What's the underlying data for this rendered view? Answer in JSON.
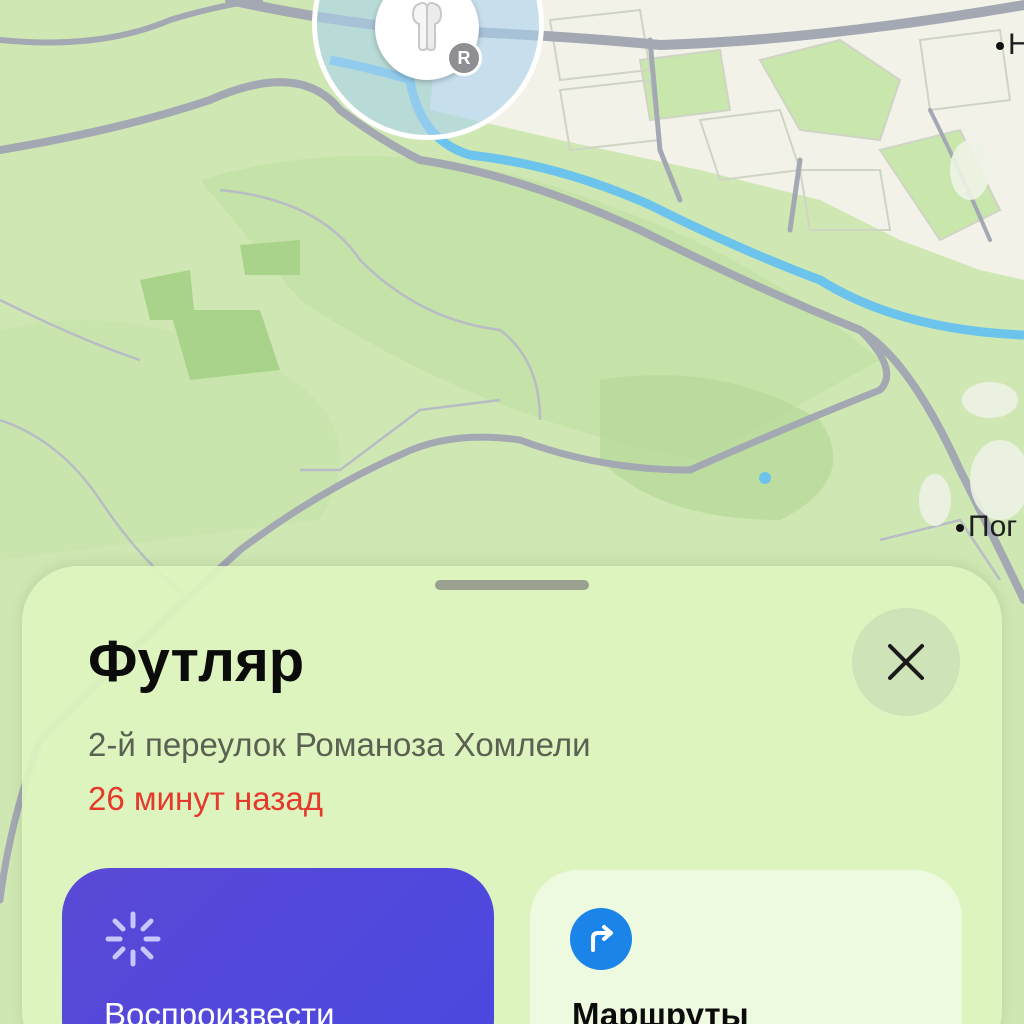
{
  "map": {
    "labels": {
      "top_right": "Н",
      "right": "Пог"
    },
    "pin": {
      "badge_letter": "R",
      "device_icon": "airpods-case-icon"
    }
  },
  "sheet": {
    "title": "Футляр",
    "address": "2-й переулок Романоза Хомлели",
    "time_ago": "26 минут назад",
    "close_icon": "close-icon",
    "actions": {
      "play": {
        "label": "Воспроизвести",
        "icon": "spinner-icon",
        "color": "#5047de"
      },
      "routes": {
        "label": "Маршруты",
        "icon": "route-arrow-icon",
        "color": "#1a84e8"
      }
    }
  },
  "colors": {
    "accent_red": "#e5392b",
    "map_green": "#cfe8b3",
    "river_blue": "#6cc4ec"
  }
}
